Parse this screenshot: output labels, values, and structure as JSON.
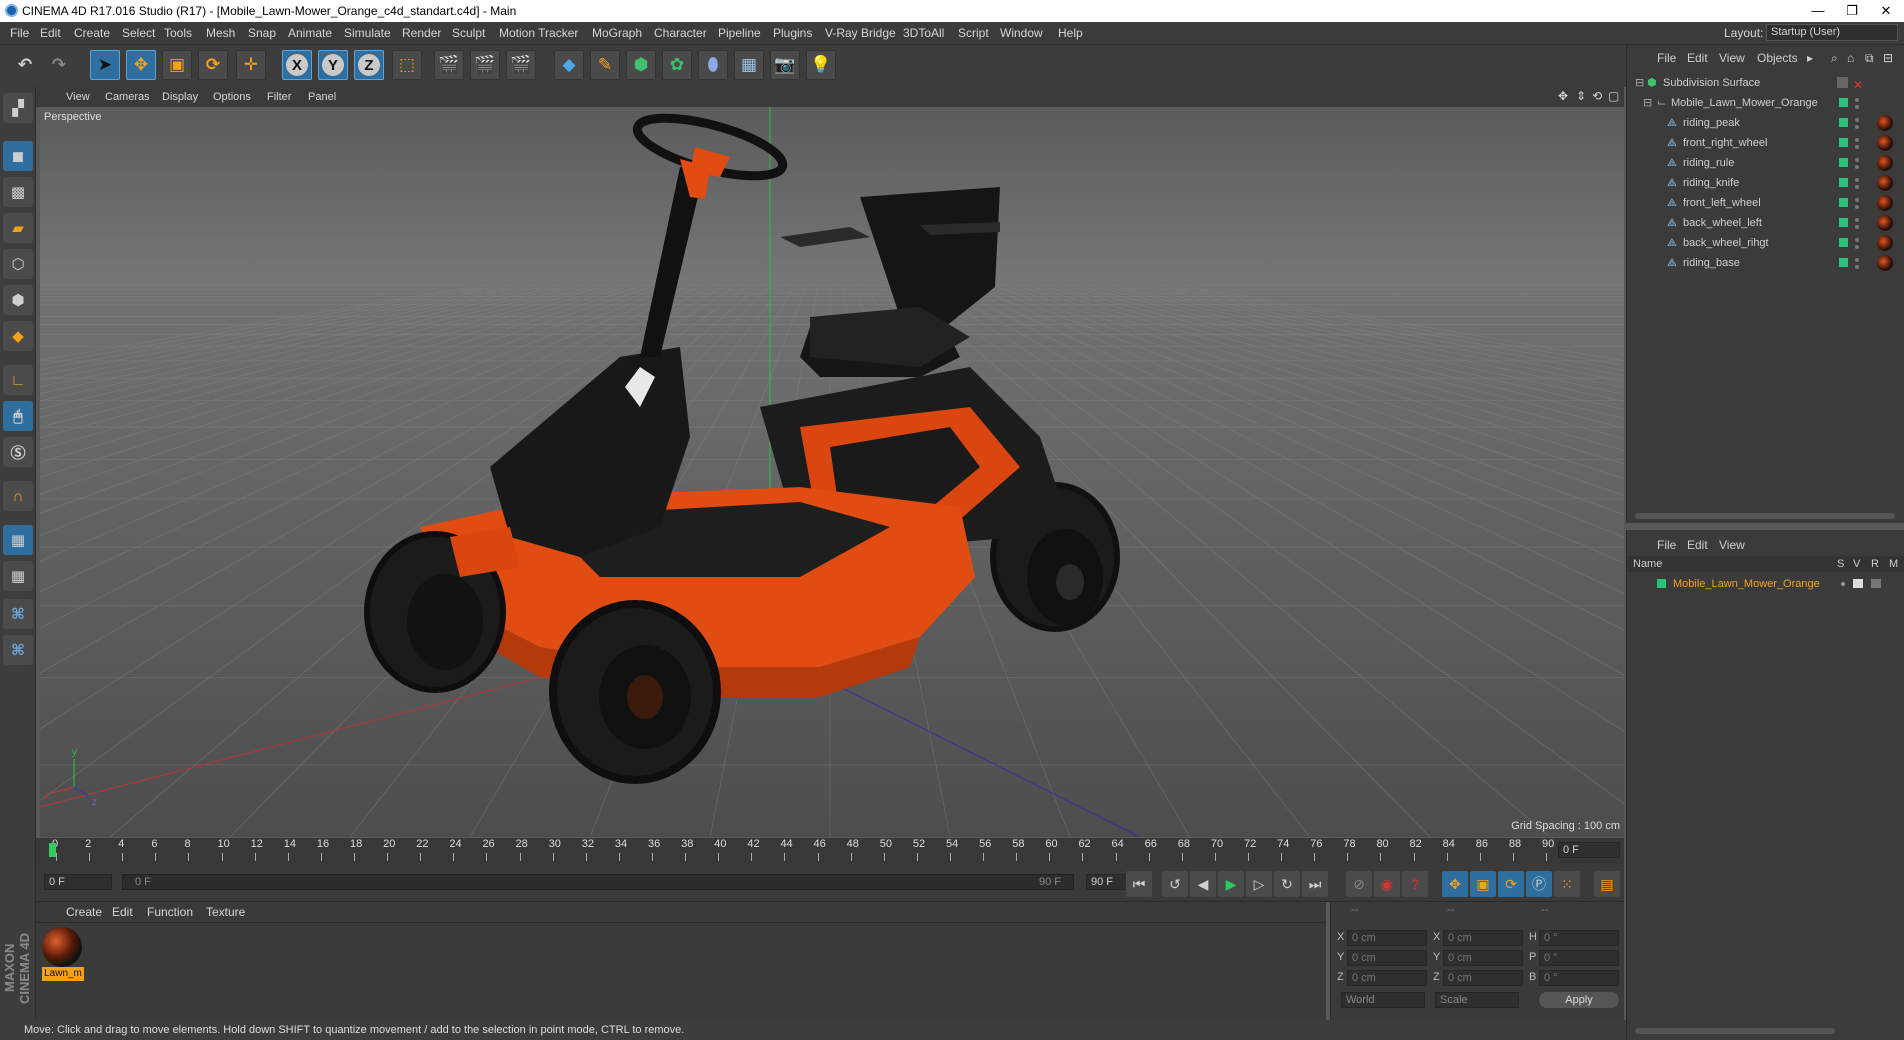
{
  "window": {
    "title": "CINEMA 4D R17.016 Studio (R17) - [Mobile_Lawn-Mower_Orange_c4d_standart.c4d] - Main",
    "controls": [
      "—",
      "❐",
      "✕"
    ]
  },
  "menu": [
    "File",
    "Edit",
    "Create",
    "Select",
    "Tools",
    "Mesh",
    "Snap",
    "Animate",
    "Simulate",
    "Render",
    "Sculpt",
    "Motion Tracker",
    "MoGraph",
    "Character",
    "Pipeline",
    "Plugins",
    "V-Ray Bridge",
    "3DToAll",
    "Script",
    "Window",
    "Help"
  ],
  "layout": {
    "label": "Layout:",
    "value": "Startup (User)"
  },
  "toolbar": {
    "axis_x": "X",
    "axis_y": "Y",
    "axis_z": "Z"
  },
  "viewport": {
    "menu": [
      "View",
      "Cameras",
      "Display",
      "Options",
      "Filter",
      "Panel"
    ],
    "label": "Perspective",
    "grid_spacing": "Grid Spacing : 100 cm",
    "axis_y": "y",
    "axis_x": "x",
    "axis_z": "z"
  },
  "timeline": {
    "ticks": [
      "0",
      "2",
      "4",
      "6",
      "8",
      "10",
      "12",
      "14",
      "16",
      "18",
      "20",
      "22",
      "24",
      "26",
      "28",
      "30",
      "32",
      "34",
      "36",
      "38",
      "40",
      "42",
      "44",
      "46",
      "48",
      "50",
      "52",
      "54",
      "56",
      "58",
      "60",
      "62",
      "64",
      "66",
      "68",
      "70",
      "72",
      "74",
      "76",
      "78",
      "80",
      "82",
      "84",
      "86",
      "88",
      "90"
    ],
    "current_frame": "0 F"
  },
  "transport": {
    "start": "0 F",
    "range_start": "0 F",
    "range_end": "90 F",
    "end": "90 F"
  },
  "materials": {
    "menu": [
      "Create",
      "Edit",
      "Function",
      "Texture"
    ],
    "items": [
      {
        "name": "Lawn_m"
      }
    ]
  },
  "coords": {
    "headers": [
      "--",
      "--",
      "--"
    ],
    "rows": [
      {
        "a_lbl": "X",
        "a": "0 cm",
        "b_lbl": "X",
        "b": "0 cm",
        "c_lbl": "H",
        "c": "0 °"
      },
      {
        "a_lbl": "Y",
        "a": "0 cm",
        "b_lbl": "Y",
        "b": "0 cm",
        "c_lbl": "P",
        "c": "0 °"
      },
      {
        "a_lbl": "Z",
        "a": "0 cm",
        "b_lbl": "Z",
        "b": "0 cm",
        "c_lbl": "B",
        "c": "0 °"
      }
    ],
    "world": "World",
    "scale": "Scale",
    "apply": "Apply"
  },
  "objects": {
    "menu": [
      "File",
      "Edit",
      "View",
      "Objects"
    ],
    "root": "Subdivision Surface",
    "group": "Mobile_Lawn_Mower_Orange",
    "children": [
      "riding_peak",
      "front_right_wheel",
      "riding_rule",
      "riding_knife",
      "front_left_wheel",
      "back_wheel_left",
      "back_wheel_rihgt",
      "riding_base"
    ]
  },
  "attributes": {
    "menu": [
      "File",
      "Edit",
      "View"
    ],
    "columns": [
      "Name",
      "S",
      "V",
      "R",
      "M"
    ],
    "row": "Mobile_Lawn_Mower_Orange"
  },
  "brand": "MAXON CINEMA 4D",
  "status": "Move: Click and drag to move elements. Hold down SHIFT to quantize movement / add to the selection in point mode, CTRL to remove."
}
